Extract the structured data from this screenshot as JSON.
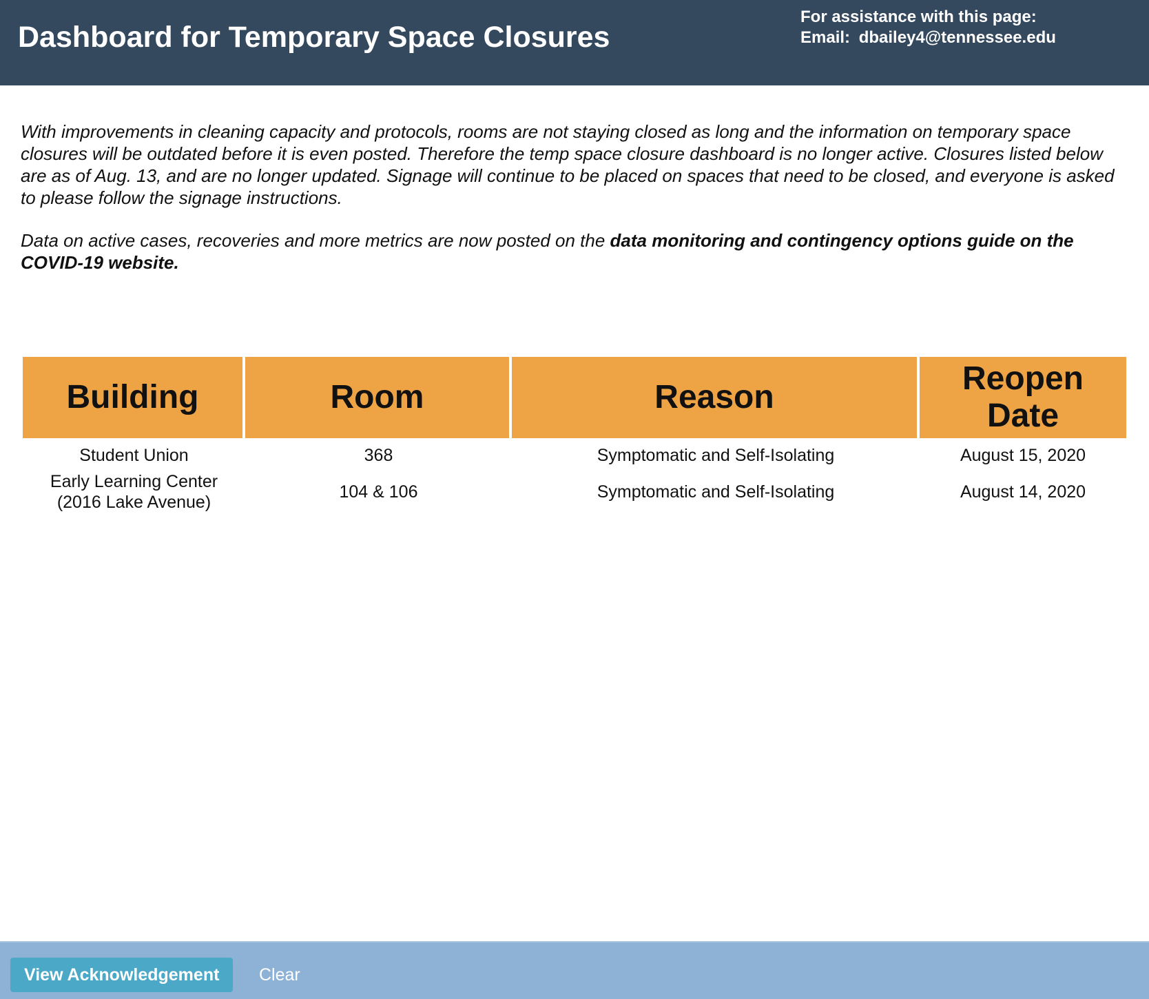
{
  "header": {
    "title": "Dashboard for Temporary Space Closures",
    "assist_line": "For assistance with this page:",
    "email_label": "Email:",
    "email": "dbailey4@tennessee.edu"
  },
  "notice": {
    "paragraph1": "With improvements in cleaning capacity and protocols, rooms are not staying closed as long and the information on temporary space closures will be outdated before it is even posted. Therefore the temp space closure dashboard is no longer active. Closures listed below are as of Aug. 13, and are no longer updated. Signage will continue to be placed on spaces that need to be closed, and everyone is asked to please follow the signage instructions.",
    "paragraph2_prefix": "Data on active cases, recoveries and more metrics are now posted on the ",
    "paragraph2_link": "data monitoring and contingency options guide on the COVID-19 website."
  },
  "table": {
    "headers": {
      "building": "Building",
      "room": "Room",
      "reason": "Reason",
      "reopen_line1": "Reopen",
      "reopen_line2": "Date"
    },
    "rows": [
      {
        "building_line1": "Student Union",
        "building_line2": "",
        "room": "368",
        "reason": "Symptomatic and Self-Isolating",
        "reopen": "August 15, 2020"
      },
      {
        "building_line1": "Early Learning Center",
        "building_line2": "(2016 Lake Avenue)",
        "room": "104 & 106",
        "reason": "Symptomatic and Self-Isolating",
        "reopen": "August 14, 2020"
      }
    ]
  },
  "footer": {
    "view_ack_label": "View Acknowledgement",
    "clear_label": "Clear"
  },
  "colors": {
    "header_bg": "#34495e",
    "table_header_bg": "#eea445",
    "footer_bg": "#8db2d6",
    "button_bg": "#4ba8c6"
  }
}
